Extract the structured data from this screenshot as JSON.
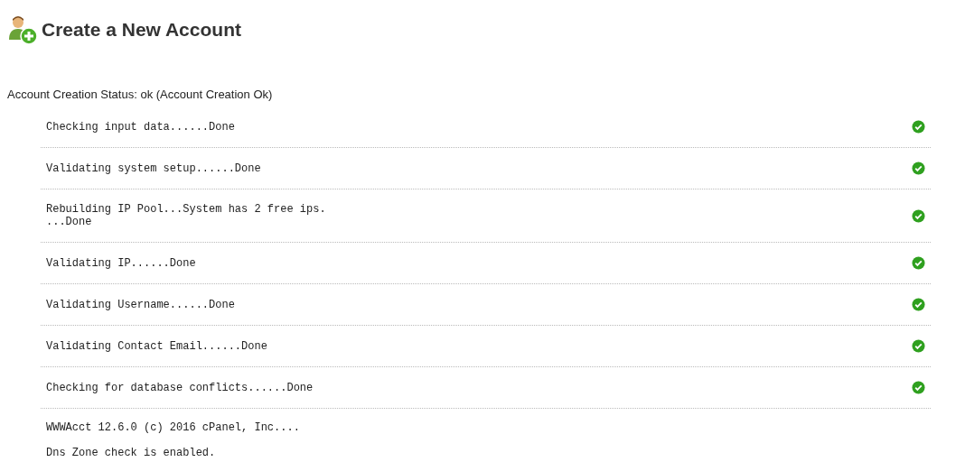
{
  "title": "Create a New Account",
  "status_line": "Account Creation Status: ok (Account Creation Ok)",
  "steps": [
    {
      "text": "Checking input data......Done",
      "ok": true
    },
    {
      "text": "Validating system setup......Done",
      "ok": true
    },
    {
      "text": "Rebuilding IP Pool...System has 2 free ips.\n...Done",
      "ok": true
    },
    {
      "text": "Validating IP......Done",
      "ok": true
    },
    {
      "text": "Validating Username......Done",
      "ok": true
    },
    {
      "text": "Validating Contact Email......Done",
      "ok": true
    },
    {
      "text": "Checking for database conflicts......Done",
      "ok": true
    }
  ],
  "log_lines": [
    "WWWAcct 12.6.0 (c) 2016 cPanel, Inc....",
    "Dns Zone check is enabled."
  ]
}
